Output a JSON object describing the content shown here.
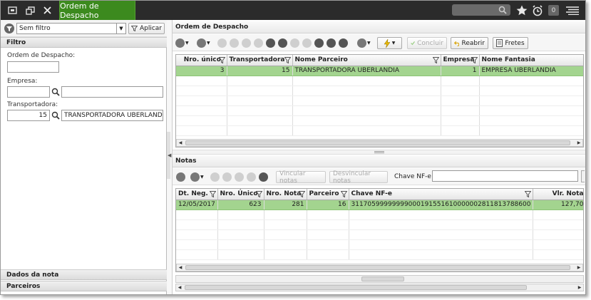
{
  "app": {
    "active_tab": "Ordem de Despacho",
    "notification_count": "0"
  },
  "filter": {
    "selected": "Sem filtro",
    "apply_label": "Aplicar",
    "section_title": "Filtro",
    "ordem_label": "Ordem de Despacho:",
    "ordem_value": "",
    "empresa_label": "Empresa:",
    "empresa_code": "",
    "empresa_name": "",
    "transportadora_label": "Transportadora:",
    "transportadora_code": "15",
    "transportadora_name": "TRANSPORTADORA UBERLANDIA",
    "section_dados": "Dados da nota",
    "section_parceiros": "Parceiros"
  },
  "ordem": {
    "title": "Ordem de Despacho",
    "buttons": {
      "concluir": "Concluir",
      "reabrir": "Reabrir",
      "fretes": "Fretes"
    },
    "columns": [
      "Nro. único",
      "Transportadora",
      "Nome Parceiro",
      "Empresa",
      "Nome Fantasia"
    ],
    "rows": [
      [
        "3",
        "15",
        "TRANSPORTADORA UBERLANDIA",
        "1",
        "EMPRESA UBERLANDIA"
      ]
    ]
  },
  "notas": {
    "title": "Notas",
    "buttons": {
      "vincular": "Vincular notas",
      "desvincular": "Desvincular notas"
    },
    "chave_label": "Chave NF-e",
    "chave_value": "",
    "columns": [
      "Dt. Neg.",
      "Nro. Único",
      "Nro. Nota",
      "Parceiro",
      "Chave NF-e",
      "Vlr. Nota"
    ],
    "rows": [
      [
        "12/05/2017",
        "623",
        "281",
        "16",
        "31170599999999000191551610000002811813788600",
        "127,70"
      ]
    ]
  },
  "colors": {
    "topbar": "#2b2b2b",
    "active_tab": "#3c8a1e",
    "selected_row": "#a3d48f"
  }
}
